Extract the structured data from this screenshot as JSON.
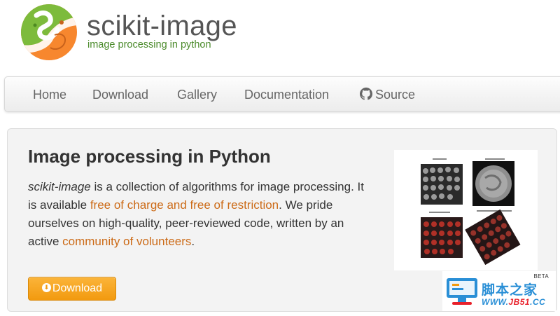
{
  "header": {
    "title": "scikit-image",
    "tagline": "image processing in python"
  },
  "nav": {
    "items": [
      {
        "label": "Home"
      },
      {
        "label": "Download"
      },
      {
        "label": "Gallery"
      },
      {
        "label": "Documentation"
      },
      {
        "label": "Source",
        "icon": "github-icon"
      }
    ]
  },
  "hero": {
    "title": "Image processing in Python",
    "text": {
      "name": "scikit-image",
      "part1": " is a collection of algorithms for image processing. It is available ",
      "link1": "free of charge and free of restriction",
      "part2": ". We pride ourselves on high-quality, peer-reviewed code, written by an active ",
      "link2": "community of volunteers",
      "part3": "."
    },
    "download_button": {
      "label": "Download",
      "icon": "download-circle-icon"
    }
  },
  "watermark": {
    "beta": "BETA",
    "title": "脚本之家",
    "url_prefix": "WWW.",
    "url_highlight": "JB51",
    "url_suffix": ".CC"
  },
  "colors": {
    "link": "#cc6b18",
    "button": "#f29a0f",
    "tagline": "#4a8a2a",
    "watermark": "#2a8fd6"
  }
}
